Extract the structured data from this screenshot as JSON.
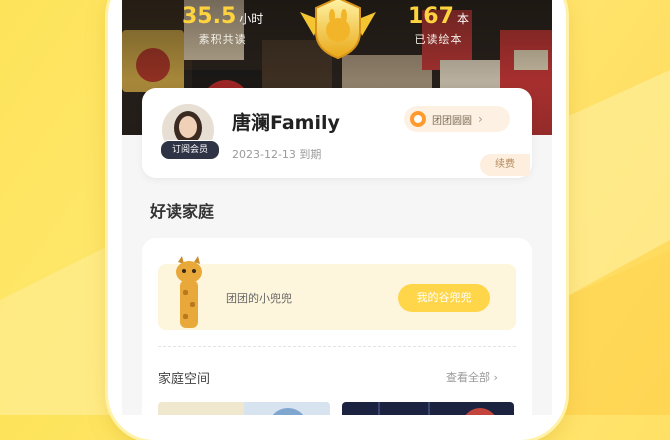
{
  "stats": {
    "hours": {
      "value": "35.5",
      "unit": "小时",
      "label": "素积共读"
    },
    "books": {
      "value": "167",
      "unit": "本",
      "label": "已读绘本"
    }
  },
  "profile": {
    "name": "唐澜Family",
    "member_tag": "订阅会员",
    "expiry": "2023-12-13 到期",
    "group_label": "团团圆圆",
    "renew_label": "续费"
  },
  "section": {
    "title": "好读家庭"
  },
  "pet": {
    "name": "团团的小兜兜",
    "button": "我的谷兜兜"
  },
  "family_space": {
    "title": "家庭空间",
    "view_all": "查看全部"
  },
  "colors": {
    "background": "#ffe46a",
    "accent_gold": "#ffd23f",
    "pet_button": "#ffd64a",
    "tag_bg": "#2f3346"
  },
  "icons": [
    "trophy-badge-icon",
    "group-dot-icon",
    "chevron-right-icon",
    "giraffe-mascot-icon"
  ]
}
